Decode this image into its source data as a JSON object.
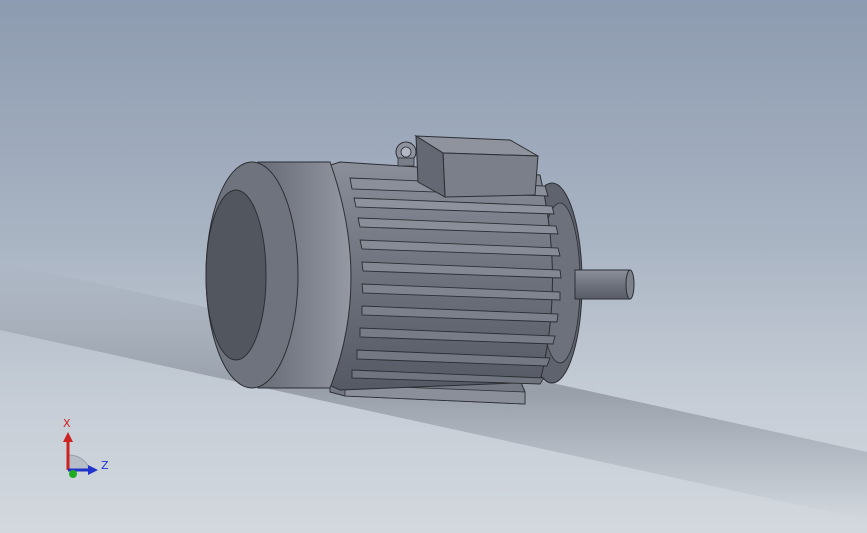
{
  "triad": {
    "x_label": "X",
    "z_label": "Z",
    "x_color": "#cc2222",
    "y_color": "#22aa22",
    "z_color": "#2233cc"
  },
  "scene": {
    "background_top": "#8d9bb0",
    "background_bottom": "#d3d8de",
    "model_color": "#6b6f7a"
  }
}
